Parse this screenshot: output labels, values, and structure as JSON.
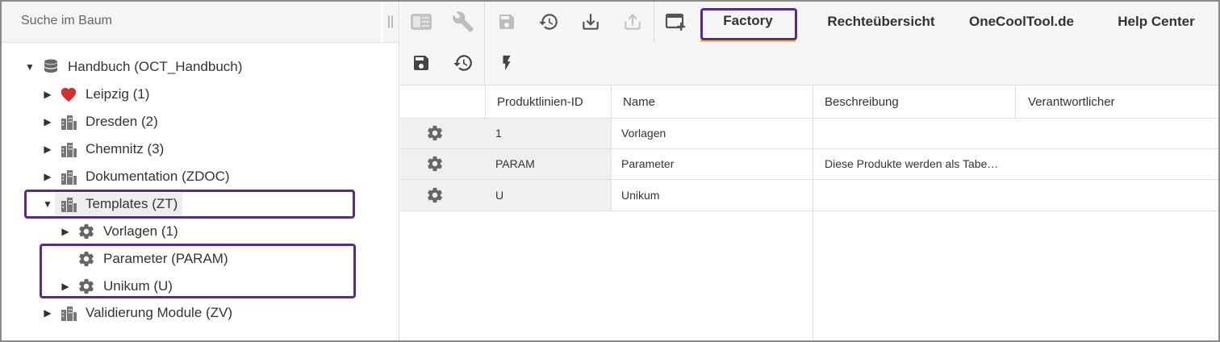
{
  "search": {
    "placeholder": "Suche im Baum"
  },
  "splitter": "||",
  "tree": {
    "root": "Handbuch (OCT_Handbuch)",
    "items": [
      {
        "label": "Leipzig (1)"
      },
      {
        "label": "Dresden (2)"
      },
      {
        "label": "Chemnitz (3)"
      },
      {
        "label": "Dokumentation (ZDOC)"
      },
      {
        "label": "Templates (ZT)"
      },
      {
        "label": "Vorlagen (1)"
      },
      {
        "label": "Parameter (PARAM)"
      },
      {
        "label": "Unikum (U)"
      },
      {
        "label": "Validierung Module (ZV)"
      }
    ]
  },
  "toolbar": {
    "icons": [
      "panel-icon",
      "wrench-icon",
      "save-icon",
      "restore-icon",
      "download-icon",
      "upload-icon",
      "new-window-icon"
    ]
  },
  "tabs": [
    {
      "label": "Factory",
      "active": true
    },
    {
      "label": "Rechteübersicht"
    },
    {
      "label": "OneCoolTool.de"
    },
    {
      "label": "Help Center"
    }
  ],
  "subtoolbar": {
    "icons": [
      "save-icon",
      "restore-icon",
      "flash-icon"
    ]
  },
  "table": {
    "columns": [
      "Produktlinien-ID",
      "Name",
      "Beschreibung",
      "Verantwortlicher"
    ],
    "rows": [
      {
        "id": "1",
        "name": "Vorlagen",
        "beschreibung": "",
        "verantwortlicher": ""
      },
      {
        "id": "PARAM",
        "name": "Parameter",
        "beschreibung": "Diese Produkte werden als Tabe…",
        "verantwortlicher": ""
      },
      {
        "id": "U",
        "name": "Unikum",
        "beschreibung": "",
        "verantwortlicher": ""
      }
    ]
  },
  "colors": {
    "highlight": "#5b2c83",
    "active_tab_underline": "#f0b84a",
    "heart": "#d32f2f",
    "icon": "#666666"
  }
}
